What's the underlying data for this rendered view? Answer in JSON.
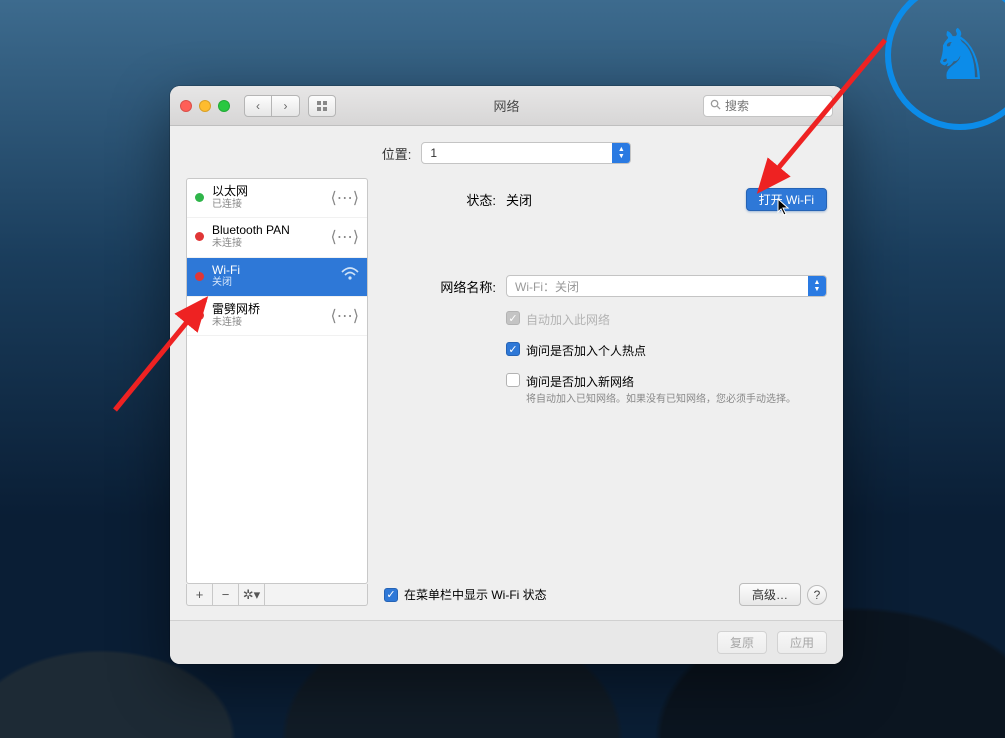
{
  "window": {
    "title": "网络",
    "search_placeholder": "搜索"
  },
  "location": {
    "label": "位置:",
    "value": "1"
  },
  "sidebar": {
    "items": [
      {
        "name": "以太网",
        "sub": "已连接",
        "status": "green",
        "icon": "double-arrow"
      },
      {
        "name": "Bluetooth PAN",
        "sub": "未连接",
        "status": "red",
        "icon": "double-arrow"
      },
      {
        "name": "Wi-Fi",
        "sub": "关闭",
        "status": "red",
        "icon": "wifi",
        "selected": true
      },
      {
        "name": "雷劈网桥",
        "sub": "未连接",
        "status": "red",
        "icon": "double-arrow"
      }
    ]
  },
  "main": {
    "status_label": "状态:",
    "status_value": "关闭",
    "turn_on_label": "打开 Wi-Fi",
    "network_name_label": "网络名称:",
    "network_name_placeholder": "Wi-Fi：关闭",
    "auto_join_label": "自动加入此网络",
    "ask_hotspot_label": "询问是否加入个人热点",
    "ask_new_label": "询问是否加入新网络",
    "ask_new_help": "将自动加入已知网络。如果没有已知网络，您必须手动选择。",
    "menubar_label": "在菜单栏中显示 Wi-Fi 状态",
    "advanced_label": "高级…"
  },
  "footer": {
    "revert": "复原",
    "apply": "应用"
  }
}
